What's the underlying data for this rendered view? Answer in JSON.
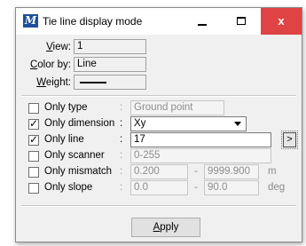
{
  "window": {
    "title": "Tie line display mode",
    "app_icon_letter": "M",
    "minimize_glyph": "minimize-icon",
    "maximize_glyph": "maximize-icon",
    "close_glyph": "x"
  },
  "display": {
    "view_label_u": "V",
    "view_label_rest": "iew:",
    "view_value": "1",
    "color_label_u": "C",
    "color_label_rest": "olor by:",
    "color_value": "Line",
    "weight_label_u": "W",
    "weight_label_rest": "eight:"
  },
  "options": {
    "only_type": {
      "label": "Only type",
      "checked": false,
      "value": "Ground point"
    },
    "only_dimension": {
      "label": "Only dimension",
      "checked": true,
      "value": "Xy"
    },
    "only_line": {
      "label": "Only line",
      "checked": true,
      "value": "17",
      "button": ">"
    },
    "only_scanner": {
      "label": "Only scanner",
      "checked": false,
      "value": "0-255"
    },
    "only_mismatch": {
      "label": "Only mismatch",
      "checked": false,
      "min": "0.200",
      "max": "9999.900",
      "unit": "m"
    },
    "only_slope": {
      "label": "Only slope",
      "checked": false,
      "min": "0.0",
      "max": "90.0",
      "unit": "deg"
    },
    "colon": ":",
    "dash": "-"
  },
  "footer": {
    "apply_u": "A",
    "apply_rest": "pply"
  }
}
